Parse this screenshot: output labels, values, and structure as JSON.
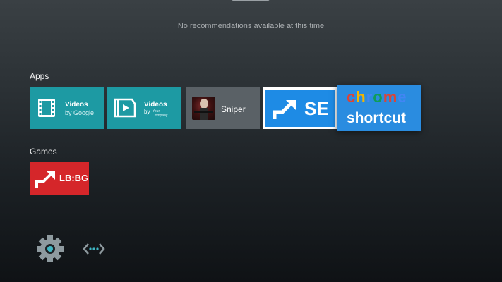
{
  "recommendations": {
    "message": "No recommendations available at this time"
  },
  "apps": {
    "title": "Apps",
    "tiles": [
      {
        "name": "Videos",
        "subtitle": "by Google",
        "icon": "film-strip-icon"
      },
      {
        "name": "Videos",
        "by": "by",
        "company": "Your Company",
        "icon": "clapperboard-play-icon"
      },
      {
        "name": "Sniper",
        "icon": "sniper-thumbnail"
      },
      {
        "name": "SE",
        "icon": "shortcut-arrow-icon"
      },
      {
        "brand": "chrome",
        "name": "shortcut"
      }
    ]
  },
  "games": {
    "title": "Games",
    "tiles": [
      {
        "name": "LB:BG",
        "icon": "shortcut-arrow-icon"
      }
    ]
  },
  "bottom": {
    "icons": [
      "settings-gear-icon",
      "network-arrows-icon"
    ]
  },
  "colors": {
    "teal": "#1d9aa3",
    "blue": "#1e8be5",
    "red": "#d5262a",
    "slate": "#5a6166"
  },
  "chrome_letter_colors": [
    "#db4437",
    "#f4b400",
    "#4285f4",
    "#0f9d58",
    "#db4437",
    "#4285f4"
  ]
}
